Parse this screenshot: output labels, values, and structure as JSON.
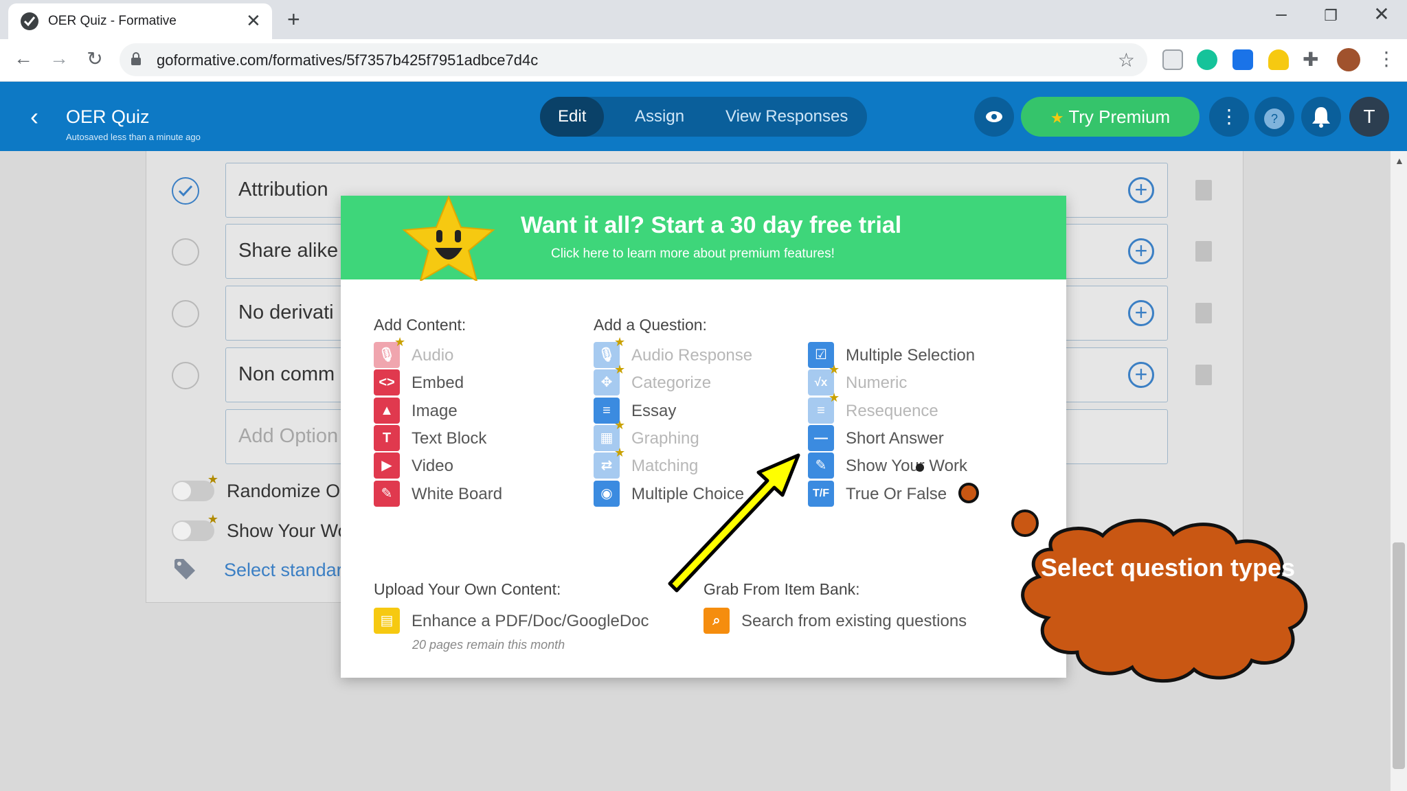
{
  "browser": {
    "tab_title": "OER Quiz - Formative",
    "url": "goformative.com/formatives/5f7357b425f7951adbce7d4c",
    "new_tab": "+",
    "tab_close": "✕"
  },
  "header": {
    "title": "OER Quiz",
    "autosave": "Autosaved less than a minute ago",
    "modes": [
      "Edit",
      "Assign",
      "View Responses"
    ],
    "premium_label": "Try Premium",
    "avatar_letter": "T",
    "help_glyph": "?"
  },
  "editor": {
    "options": [
      "Attribution",
      "Share alike",
      "No derivati",
      "Non comm"
    ],
    "add_option_placeholder": "Add Option",
    "settings": [
      "Randomize Or",
      "Show Your Wo"
    ],
    "select_standards": "Select standar"
  },
  "modal": {
    "banner_heading": "Want it all? Start a 30 day free trial",
    "banner_sub": "Click here to learn more about premium features!",
    "add_content_heading": "Add Content:",
    "add_question_heading": "Add a Question:",
    "upload_heading": "Upload Your Own Content:",
    "grab_heading": "Grab From Item Bank:",
    "content_items": [
      {
        "label": "Audio",
        "icon": "mic-icon",
        "glyph": "🎙",
        "premium": true
      },
      {
        "label": "Embed",
        "icon": "code-icon",
        "glyph": "<>",
        "premium": false
      },
      {
        "label": "Image",
        "icon": "mountain-icon",
        "glyph": "▲",
        "premium": false
      },
      {
        "label": "Text Block",
        "icon": "text-icon",
        "glyph": "T",
        "premium": false
      },
      {
        "label": "Video",
        "icon": "play-icon",
        "glyph": "▶",
        "premium": false
      },
      {
        "label": "White Board",
        "icon": "whiteboard-icon",
        "glyph": "✎",
        "premium": false
      }
    ],
    "question_col1": [
      {
        "label": "Audio Response",
        "icon": "mic-icon",
        "glyph": "🎙",
        "premium": true
      },
      {
        "label": "Categorize",
        "icon": "categorize-icon",
        "glyph": "✥",
        "premium": true
      },
      {
        "label": "Essay",
        "icon": "essay-icon",
        "glyph": "≡",
        "premium": false
      },
      {
        "label": "Graphing",
        "icon": "grid-icon",
        "glyph": "▦",
        "premium": true
      },
      {
        "label": "Matching",
        "icon": "matching-icon",
        "glyph": "⇄",
        "premium": true
      },
      {
        "label": "Multiple Choice",
        "icon": "radio-icon",
        "glyph": "◉",
        "premium": false
      }
    ],
    "question_col2": [
      {
        "label": "Multiple Selection",
        "icon": "checkbox-icon",
        "glyph": "☑",
        "premium": false
      },
      {
        "label": "Numeric",
        "icon": "sqrt-icon",
        "glyph": "√x",
        "premium": true
      },
      {
        "label": "Resequence",
        "icon": "resequence-icon",
        "glyph": "≡",
        "premium": true
      },
      {
        "label": "Short Answer",
        "icon": "short-answer-icon",
        "glyph": "—",
        "premium": false
      },
      {
        "label": "Show Your Work",
        "icon": "pencil-icon",
        "glyph": "✎",
        "premium": false
      },
      {
        "label": "True Or False",
        "icon": "true-false-icon",
        "glyph": "T/F",
        "premium": false
      }
    ],
    "upload_item": {
      "label": "Enhance a PDF/Doc/GoogleDoc",
      "icon": "document-icon",
      "glyph": "▤"
    },
    "pages_note": "20 pages remain this month",
    "grab_item": {
      "label": "Search from existing questions",
      "icon": "search-icon",
      "glyph": "⌕"
    }
  },
  "annotation": {
    "callout": "Select question types"
  },
  "colors": {
    "header_blue": "#0d79c5",
    "banner_green": "#3ed67a",
    "premium_green": "#35c46b",
    "content_red": "#e0394e",
    "question_blue": "#3b8be0",
    "callout_orange": "#c95713",
    "arrow_yellow": "#ffff00"
  }
}
